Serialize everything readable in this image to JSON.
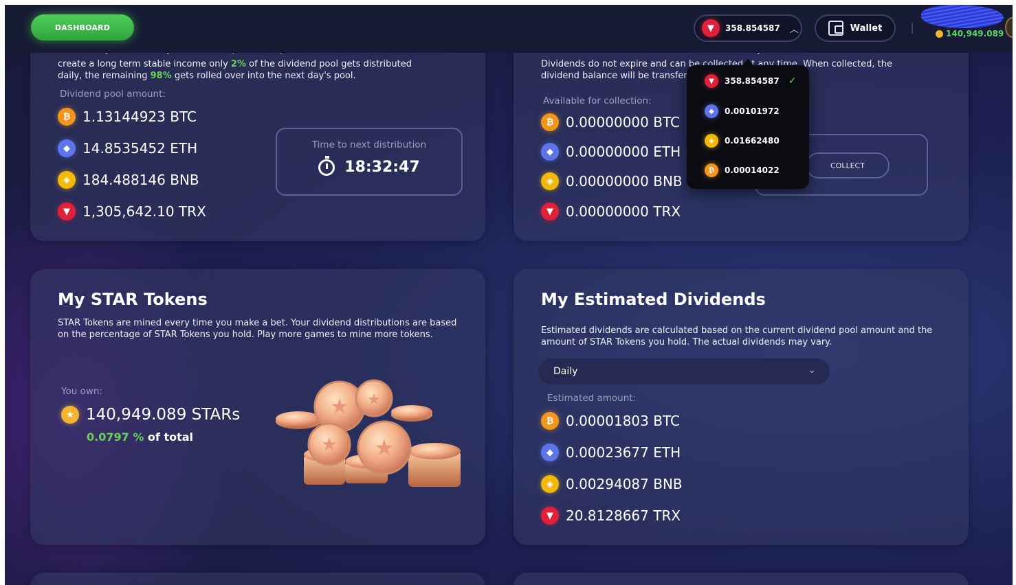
{
  "header": {
    "dashboard_label": "DASHBOARD",
    "balance": "358.854587",
    "wallet_label": "Wallet",
    "star_balance": "140,949.089"
  },
  "currency_dropdown": {
    "items": [
      {
        "coin": "trx",
        "value": "358.854587",
        "selected": true
      },
      {
        "coin": "eth",
        "value": "0.00101972"
      },
      {
        "coin": "bnb",
        "value": "0.01662480"
      },
      {
        "coin": "btc",
        "value": "0.00014022"
      }
    ]
  },
  "pool_card": {
    "desc_cut": "Dividend system is a way to distribute platform's profits between our users. To",
    "desc_line2_a": "create a long term stable income only ",
    "desc_pct1": "2%",
    "desc_line2_b": " of the dividend pool gets distributed",
    "desc_line3_a": "daily, the remaining ",
    "desc_pct2": "98%",
    "desc_line3_b": " gets rolled over into the next day's pool.",
    "pool_label": "Dividend pool amount:",
    "amounts": [
      {
        "coin": "btc",
        "text": "1.13144923 BTC"
      },
      {
        "coin": "eth",
        "text": "14.8535452 ETH"
      },
      {
        "coin": "bnb",
        "text": "184.488146 BNB"
      },
      {
        "coin": "trx",
        "text": "1,305,642.10 TRX"
      }
    ],
    "timer_label": "Time to next distribution",
    "timer_value": "18:32:47"
  },
  "dividend_card": {
    "desc_cut": "Your dividend balance is an accumulation of daily dividend distributions.",
    "desc_line2": "Dividends do not expire and can be collected at any time. When collected, the",
    "desc_line3": "dividend balance will be transferred to this wallet.",
    "available_label": "Available for collection:",
    "amounts": [
      {
        "coin": "btc",
        "text": "0.00000000 BTC"
      },
      {
        "coin": "eth",
        "text": "0.00000000 ETH"
      },
      {
        "coin": "bnb",
        "text": "0.00000000 BNB"
      },
      {
        "coin": "trx",
        "text": "0.00000000 TRX"
      }
    ],
    "collect_label": "COLLECT"
  },
  "star_card": {
    "title": "My STAR Tokens",
    "desc": "STAR Tokens are mined every time you make a bet. Your dividend distributions are based on the percentage of STAR Tokens you hold. Play more games to mine more tokens.",
    "own_label": "You own:",
    "own_amount": "140,949.089 STARs",
    "pct_value": "0.0797 %",
    "pct_suffix": " of total"
  },
  "estimate_card": {
    "title": "My Estimated Dividends",
    "desc": "Estimated dividends are calculated based on the current dividend pool amount and the amount of STAR Tokens you hold. The actual dividends may vary.",
    "period_selected": "Daily",
    "estimated_label": "Estimated amount:",
    "amounts": [
      {
        "coin": "btc",
        "text": "0.00001803 BTC"
      },
      {
        "coin": "eth",
        "text": "0.00023677 ETH"
      },
      {
        "coin": "bnb",
        "text": "0.00294087 BNB"
      },
      {
        "coin": "trx",
        "text": "20.8128667 TRX"
      }
    ]
  },
  "colors": {
    "accent_green": "#66d35b",
    "btc": "#f2951d",
    "eth": "#5d75e8",
    "bnb": "#f0b90b",
    "trx": "#e0213b"
  }
}
